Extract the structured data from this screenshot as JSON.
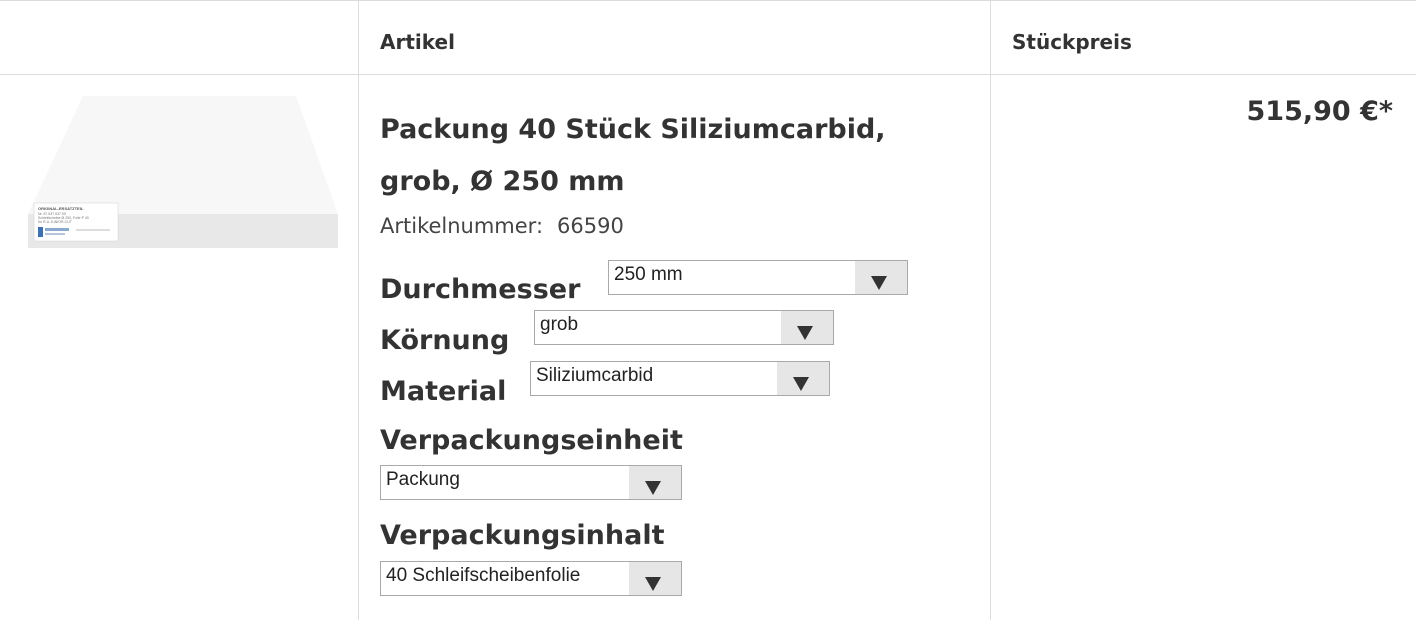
{
  "header": {
    "col_article": "Artikel",
    "col_price": "Stückpreis"
  },
  "product": {
    "title": "Packung 40 Stück Siliziumcarbid, grob, Ø 250 mm",
    "article_number_label": "Artikelnummer:",
    "article_number": "66590",
    "price": "515,90 €*",
    "image_label_lines": [
      "ORIGINAL-ERSATZTEIL",
      "Nr. 87 537 637 00",
      "Schleifscheibe Ø 250, Folie P 40",
      "für R-U-JUNIOR-CUT"
    ]
  },
  "options": {
    "diameter": {
      "label": "Durchmesser",
      "value": "250 mm"
    },
    "grit": {
      "label": "Körnung",
      "value": "grob"
    },
    "material": {
      "label": "Material",
      "value": "Siliziumcarbid"
    },
    "packaging_unit": {
      "label": "Verpackungseinheit",
      "value": "Packung"
    },
    "packaging_content": {
      "label": "Verpackungsinhalt",
      "value": "40 Schleifscheibenfolie"
    }
  },
  "colors": {
    "border": "#dcdcdc",
    "text": "#333333",
    "select_button": "#e6e6e6"
  }
}
